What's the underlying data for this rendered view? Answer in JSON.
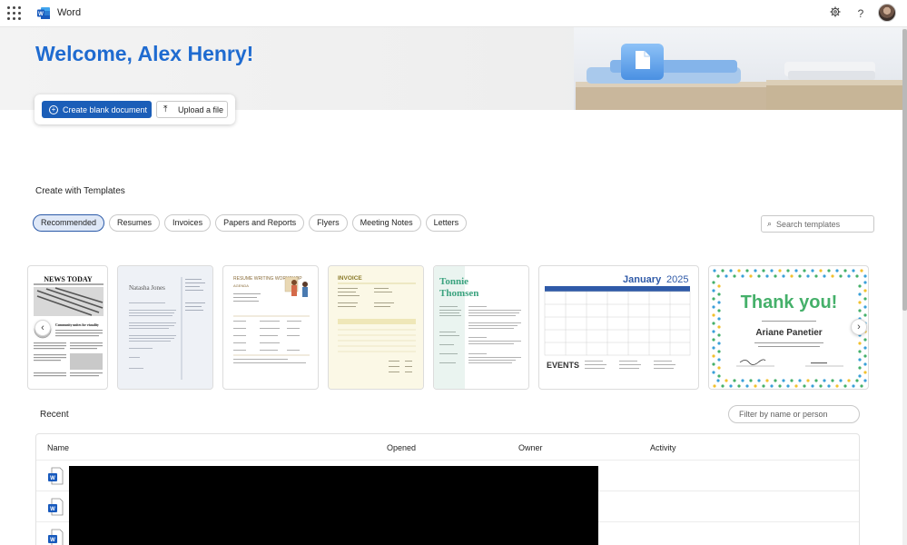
{
  "app": {
    "name": "Word"
  },
  "header": {
    "settings_icon": "gear-icon",
    "help_label": "?"
  },
  "hero": {
    "welcome": "Welcome, Alex Henry!"
  },
  "actions": {
    "create_blank": "Create blank document",
    "upload": "Upload a file"
  },
  "templates": {
    "title": "Create with Templates",
    "search_placeholder": "Search templates",
    "filters": [
      "Recommended",
      "Resumes",
      "Invoices",
      "Papers and Reports",
      "Flyers",
      "Meeting Notes",
      "Letters"
    ],
    "active_filter": "Recommended",
    "cards": {
      "news": {
        "masthead": "NEWS TODAY",
        "headline": "Community unites for visuality"
      },
      "resume1": {
        "name": "Natasha Jones"
      },
      "workshop": {
        "title": "RESUME WRITING WORKSHOP",
        "subtitle": "AGENDA"
      },
      "invoice": {
        "title": "INVOICE"
      },
      "resume2": {
        "first": "Tonnie",
        "last": "Thomsen"
      },
      "calendar": {
        "month": "January",
        "year": "2025",
        "events": "EVENTS"
      },
      "thanks": {
        "title": "Thank you!",
        "name": "Ariane Panetier"
      }
    }
  },
  "recent": {
    "title": "Recent",
    "filter_placeholder": "Filter by name or person",
    "columns": {
      "name": "Name",
      "opened": "Opened",
      "owner": "Owner",
      "activity": "Activity"
    }
  }
}
